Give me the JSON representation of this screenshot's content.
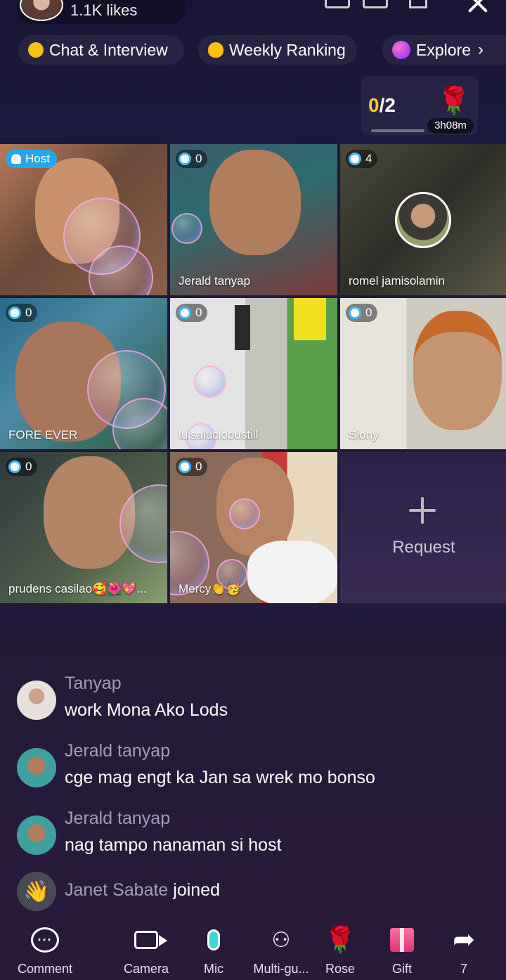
{
  "header": {
    "likes": "1.1K likes"
  },
  "chips": [
    {
      "label": "Chat & Interview"
    },
    {
      "label": "Weekly Ranking"
    },
    {
      "label": "Explore"
    }
  ],
  "goal": {
    "current": "0",
    "total": "/2",
    "timer": "3h08m",
    "gift_icon": "rose"
  },
  "host_badge": "Host",
  "guests": [
    {
      "name": "",
      "score": "",
      "is_host": true
    },
    {
      "name": "Jerald tanyap",
      "score": "0"
    },
    {
      "name": "romel jamisolamin",
      "score": "4"
    },
    {
      "name": "FORE EVER",
      "score": "0"
    },
    {
      "name": "luisaluciobustill",
      "score": "0"
    },
    {
      "name": "Siony",
      "score": "0"
    },
    {
      "name": "prudens casilao🥰🌺💖...",
      "score": "0"
    },
    {
      "name": "Mercy👏🥳",
      "score": "0"
    }
  ],
  "request": {
    "label": "Request"
  },
  "chat": [
    {
      "user": "Tanyap",
      "message": "work Mona Ako Lods"
    },
    {
      "user": "Jerald tanyap",
      "message": "cge mag engt ka Jan sa wrek mo bonso"
    },
    {
      "user": "Jerald tanyap",
      "message": "nag tampo nanaman si host"
    }
  ],
  "join_event": {
    "user": "Janet Sabate",
    "text": "joined"
  },
  "bottom_bar": [
    {
      "label": "Comment",
      "icon": "comment-icon"
    },
    {
      "label": "Camera",
      "icon": "camera-icon"
    },
    {
      "label": "Mic",
      "icon": "mic-icon"
    },
    {
      "label": "Multi-gu...",
      "icon": "multi-guest-icon"
    },
    {
      "label": "Rose",
      "icon": "rose-icon"
    },
    {
      "label": "Gift",
      "icon": "gift-icon"
    },
    {
      "label": "7",
      "icon": "share-icon"
    }
  ],
  "colors": {
    "accent_blue": "#26a8e6",
    "goal_yellow": "#ffc829",
    "mic_teal": "#3dd6dc"
  }
}
